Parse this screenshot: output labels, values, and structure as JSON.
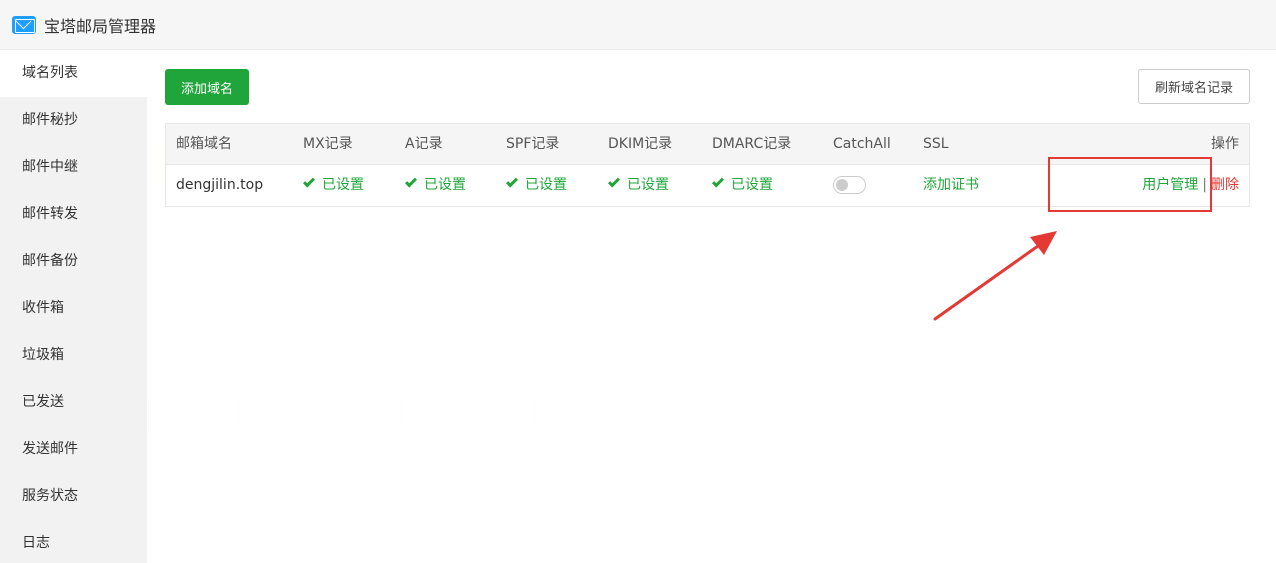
{
  "window": {
    "title": "宝塔邮局管理器"
  },
  "sidebar": {
    "items": [
      {
        "label": "域名列表"
      },
      {
        "label": "邮件秘抄"
      },
      {
        "label": "邮件中继"
      },
      {
        "label": "邮件转发"
      },
      {
        "label": "邮件备份"
      },
      {
        "label": "收件箱"
      },
      {
        "label": "垃圾箱"
      },
      {
        "label": "已发送"
      },
      {
        "label": "发送邮件"
      },
      {
        "label": "服务状态"
      },
      {
        "label": "日志"
      }
    ]
  },
  "toolbar": {
    "add_label": "添加域名",
    "refresh_label": "刷新域名记录"
  },
  "table": {
    "headers": {
      "domain": "邮箱域名",
      "mx": "MX记录",
      "a": "A记录",
      "spf": "SPF记录",
      "dkim": "DKIM记录",
      "dmarc": "DMARC记录",
      "catchall": "CatchAll",
      "ssl": "SSL",
      "ops": "操作"
    },
    "rows": [
      {
        "domain": "dengjilin.top",
        "mx": "已设置",
        "a": "已设置",
        "spf": "已设置",
        "dkim": "已设置",
        "dmarc": "已设置",
        "catchall_on": false,
        "ssl": "添加证书",
        "ops": {
          "user_manage": "用户管理",
          "separator": "|",
          "delete": "删除"
        }
      }
    ]
  },
  "colors": {
    "accent": "#20a53a",
    "danger": "#e53935",
    "highlight": "#e53935"
  }
}
